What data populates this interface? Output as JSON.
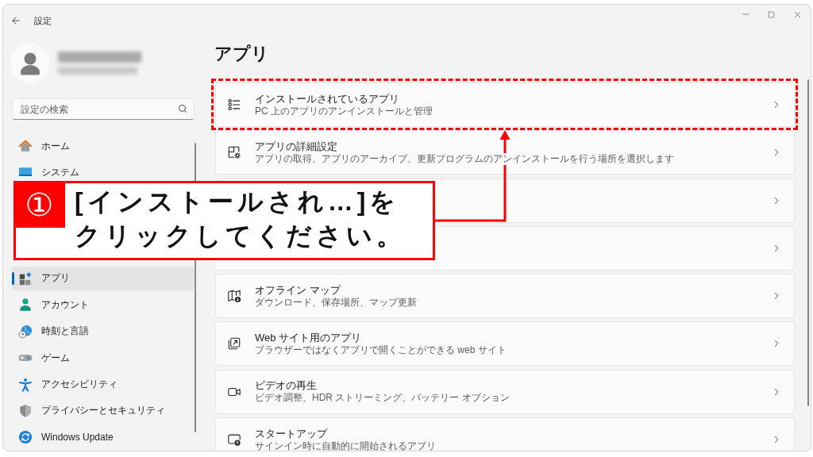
{
  "window": {
    "title": "設定"
  },
  "search": {
    "placeholder": "設定の検索"
  },
  "sidebar": {
    "items": [
      {
        "kind": "nav",
        "label": "ホーム",
        "selected": false
      },
      {
        "kind": "nav",
        "label": "システム",
        "selected": false
      },
      {
        "kind": "covered"
      },
      {
        "kind": "covered"
      },
      {
        "kind": "covered"
      },
      {
        "kind": "nav",
        "label": "アプリ",
        "selected": true
      },
      {
        "kind": "nav",
        "label": "アカウント",
        "selected": false
      },
      {
        "kind": "nav",
        "label": "時刻と言語",
        "selected": false
      },
      {
        "kind": "nav",
        "label": "ゲーム",
        "selected": false
      },
      {
        "kind": "nav",
        "label": "アクセシビリティ",
        "selected": false
      },
      {
        "kind": "nav",
        "label": "プライバシーとセキュリティ",
        "selected": false
      },
      {
        "kind": "nav",
        "label": "Windows Update",
        "selected": false
      }
    ]
  },
  "page": {
    "title": "アプリ"
  },
  "cards": [
    {
      "kind": "link",
      "title": "インストールされているアプリ",
      "description": "PC 上のアプリのアンインストールと管理",
      "highlighted": true
    },
    {
      "kind": "link",
      "title": "アプリの詳細設定",
      "description": "アプリの取得、アプリのアーカイブ、更新プログラムのアンインストールを行う場所を選択します",
      "highlighted": false
    },
    {
      "kind": "covered",
      "highlighted": false
    },
    {
      "kind": "covered",
      "highlighted": false
    },
    {
      "kind": "link",
      "title": "オフライン マップ",
      "description": "ダウンロード、保存場所、マップ更新",
      "highlighted": false
    },
    {
      "kind": "link",
      "title": "Web サイト用のアプリ",
      "description": "ブラウザーではなくアプリで開くことができる web サイト",
      "highlighted": false
    },
    {
      "kind": "link",
      "title": "ビデオの再生",
      "description": "ビデオ調整、HDR ストリーミング、バッテリー オプション",
      "highlighted": false
    },
    {
      "kind": "link",
      "title": "スタートアップ",
      "description": "サインイン時に自動的に開始されるアプリ",
      "highlighted": false
    }
  ],
  "callout": {
    "step": "①",
    "lines": [
      "[インストールされ…]を",
      "クリックしてください。"
    ]
  }
}
